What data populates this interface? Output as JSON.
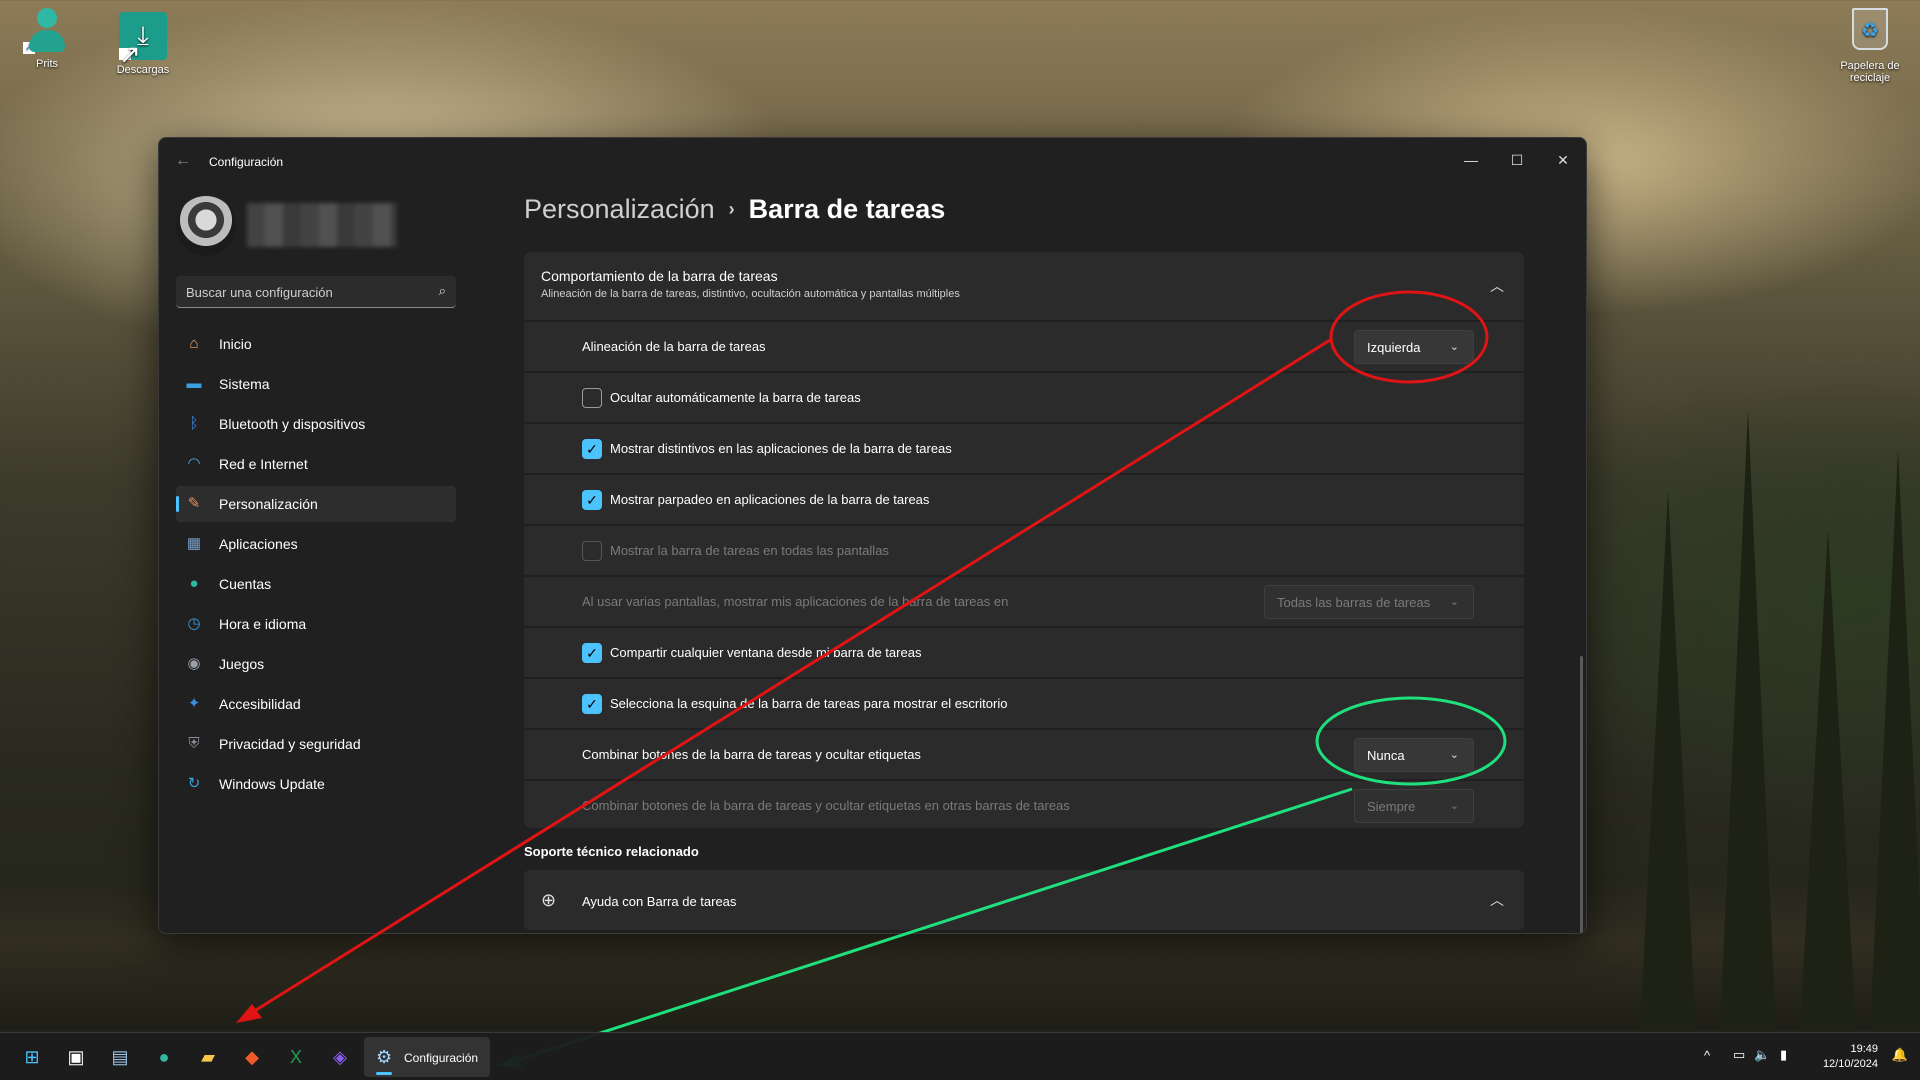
{
  "desktop": {
    "icons": [
      {
        "label": "Prits",
        "icon": "person-icon"
      },
      {
        "label": "Descargas",
        "icon": "download-folder-icon"
      },
      {
        "label": "Papelera de reciclaje",
        "icon": "recycle-bin-icon"
      }
    ]
  },
  "window": {
    "title": "Configuración",
    "controls": {
      "minimize": "—",
      "maximize": "☐",
      "close": "✕"
    }
  },
  "sidebar": {
    "search_placeholder": "Buscar una configuración",
    "items": [
      {
        "label": "Inicio",
        "icon": "home-icon",
        "color": "#f0a868"
      },
      {
        "label": "Sistema",
        "icon": "system-icon",
        "color": "#3a9ee0"
      },
      {
        "label": "Bluetooth y dispositivos",
        "icon": "bluetooth-icon",
        "color": "#3a8de0"
      },
      {
        "label": "Red e Internet",
        "icon": "wifi-icon",
        "color": "#4aa8e8"
      },
      {
        "label": "Personalización",
        "icon": "brush-icon",
        "color": "#e89060",
        "active": true
      },
      {
        "label": "Aplicaciones",
        "icon": "apps-icon",
        "color": "#7aa0c8"
      },
      {
        "label": "Cuentas",
        "icon": "account-icon",
        "color": "#2fb89a"
      },
      {
        "label": "Hora e idioma",
        "icon": "clock-globe-icon",
        "color": "#3aa0e0"
      },
      {
        "label": "Juegos",
        "icon": "gamepad-icon",
        "color": "#9aa0a8"
      },
      {
        "label": "Accesibilidad",
        "icon": "accessibility-icon",
        "color": "#3a8de0"
      },
      {
        "label": "Privacidad y seguridad",
        "icon": "shield-icon",
        "color": "#8a8f96"
      },
      {
        "label": "Windows Update",
        "icon": "update-icon",
        "color": "#3aa0e0"
      }
    ]
  },
  "breadcrumb": {
    "parent": "Personalización",
    "separator": "›",
    "current": "Barra de tareas"
  },
  "behavior": {
    "title": "Comportamiento de la barra de tareas",
    "subtitle": "Alineación de la barra de tareas, distintivo, ocultación automática y pantallas múltiples",
    "rows": [
      {
        "type": "dropdown",
        "label": "Alineación de la barra de tareas",
        "value": "Izquierda",
        "disabled": false
      },
      {
        "type": "checkbox",
        "label": "Ocultar automáticamente la barra de tareas",
        "checked": false,
        "disabled": false
      },
      {
        "type": "checkbox",
        "label": "Mostrar distintivos en las aplicaciones de la barra de tareas",
        "checked": true,
        "disabled": false
      },
      {
        "type": "checkbox",
        "label": "Mostrar parpadeo en aplicaciones de la barra de tareas",
        "checked": true,
        "disabled": false
      },
      {
        "type": "checkbox",
        "label": "Mostrar la barra de tareas en todas las pantallas",
        "checked": false,
        "disabled": true
      },
      {
        "type": "dropdown",
        "label": "Al usar varias pantallas, mostrar mis aplicaciones de la barra de tareas en",
        "value": "Todas las barras de tareas",
        "disabled": true
      },
      {
        "type": "checkbox",
        "label": "Compartir cualquier ventana desde mi barra de tareas",
        "checked": true,
        "disabled": false
      },
      {
        "type": "checkbox",
        "label": "Selecciona la esquina de la barra de tareas para mostrar el escritorio",
        "checked": true,
        "disabled": false
      },
      {
        "type": "dropdown",
        "label": "Combinar botones de la barra de tareas y ocultar etiquetas",
        "value": "Nunca",
        "disabled": false
      },
      {
        "type": "dropdown",
        "label": "Combinar botones de la barra de tareas y ocultar etiquetas en otras barras de tareas",
        "value": "Siempre",
        "disabled": true
      }
    ]
  },
  "related": {
    "title": "Soporte técnico relacionado",
    "help_label": "Ayuda con Barra de tareas",
    "help_icon": "globe-icon"
  },
  "taskbar": {
    "apps": [
      {
        "icon": "windows-start-icon",
        "color": "#4cc2ff"
      },
      {
        "icon": "task-view-icon",
        "color": "#ffffff"
      },
      {
        "icon": "widgets-icon",
        "color": "#9fc7e8"
      },
      {
        "icon": "contacts-icon",
        "color": "#2fb8a4"
      },
      {
        "icon": "file-explorer-icon",
        "color": "#f5c64a"
      },
      {
        "icon": "brave-icon",
        "color": "#f05a28"
      },
      {
        "icon": "excel-icon",
        "color": "#1f9d55"
      },
      {
        "icon": "purple-app-icon",
        "color": "#8a5cf0"
      }
    ],
    "active_app_label": "Configuración",
    "time": "19:49",
    "date": "12/10/2024"
  },
  "annotations": {
    "red_color": "#e01414",
    "green_color": "#1fe07c"
  }
}
